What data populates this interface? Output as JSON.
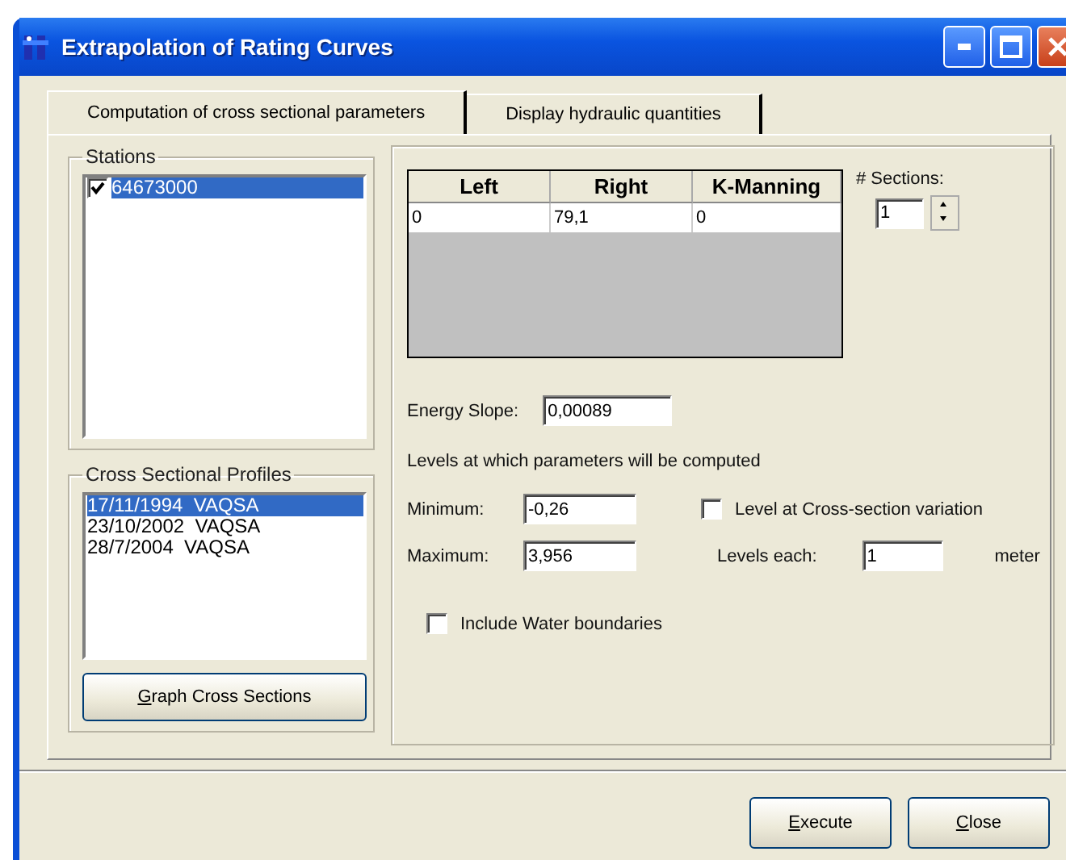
{
  "window": {
    "title": "Extrapolation of Rating Curves"
  },
  "tabs": [
    {
      "label": "Computation of cross sectional parameters",
      "selected": true
    },
    {
      "label": "Display hydraulic quantities",
      "selected": false
    }
  ],
  "stations": {
    "title": "Stations",
    "items": [
      {
        "label": "64673000",
        "checked": true,
        "selected": true
      }
    ]
  },
  "profiles": {
    "title": "Cross Sectional Profiles",
    "items": [
      {
        "label": "17/11/1994  VAQSA",
        "selected": true
      },
      {
        "label": "23/10/2002  VAQSA",
        "selected": false
      },
      {
        "label": "28/7/2004  VAQSA",
        "selected": false
      }
    ],
    "button": {
      "label": "Graph Cross Sections",
      "underline_first": true
    }
  },
  "grid": {
    "columns": [
      "Left",
      "Right",
      "K-Manning"
    ],
    "rows": [
      [
        "0",
        "79,1",
        "0"
      ]
    ]
  },
  "sections": {
    "label": "# Sections:",
    "value": "1"
  },
  "energy_slope": {
    "label": "Energy Slope:",
    "value": "0,00089"
  },
  "levels_caption": "Levels at which parameters will be computed",
  "minimum": {
    "label": "Minimum:",
    "value": "-0,26"
  },
  "maximum": {
    "label": "Maximum:",
    "value": "3,956"
  },
  "level_variation": {
    "label": "Level at Cross-section variation",
    "checked": false
  },
  "levels_each": {
    "label": "Levels each:",
    "value": "1",
    "unit": "meter"
  },
  "water_boundaries": {
    "label": "Include Water boundaries",
    "checked": false
  },
  "buttons": [
    {
      "label": "Execute",
      "underline_first": true
    },
    {
      "label": "Close",
      "underline_first": true
    }
  ]
}
